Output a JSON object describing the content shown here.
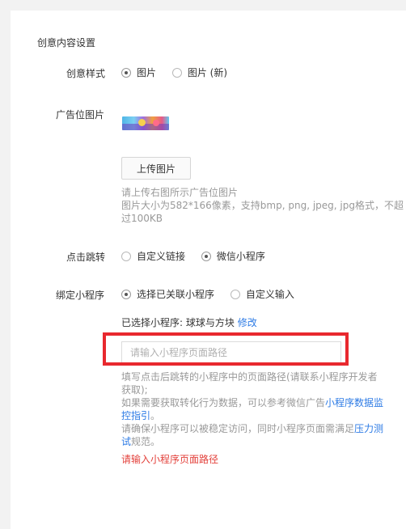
{
  "section_title": "创意内容设置",
  "style_row": {
    "label": "创意样式",
    "options": [
      "图片",
      "图片 (新)"
    ],
    "selected": 0
  },
  "image_row": {
    "label": "广告位图片",
    "upload_label": "上传图片",
    "help_line1": "请上传右图所示广告位图片",
    "help_line2": "图片大小为582*166像素，支持bmp, png, jpeg, jpg格式，不超",
    "help_line3": "过100KB"
  },
  "jump_row": {
    "label": "点击跳转",
    "options": [
      "自定义链接",
      "微信小程序"
    ],
    "selected": 1
  },
  "bind_row": {
    "label": "绑定小程序",
    "options": [
      "选择已关联小程序",
      "自定义输入"
    ],
    "selected": 0,
    "selected_text": "已选择小程序: 球球与方块",
    "modify_link": "修改",
    "path_placeholder": "请输入小程序页面路径",
    "help1_line1": "填写点击后跳转的小程序中的页面路径(请联系小程序开发者",
    "help1_line2": "获取);",
    "help2_prefix": "如果需要获取转化行为数据，可以参考微信广告",
    "help2_link_a": "小程序数据监",
    "help2_link_b": "控指引",
    "help2_suffix": "。",
    "help3_prefix": "请确保小程序可以被稳定访问，同时小程序页面需满足",
    "help3_link_a": "压力测",
    "help3_link_b": "试",
    "help3_suffix": "规范。",
    "error_text": "请输入小程序页面路径"
  },
  "colors": {
    "link": "#2d7be5",
    "error": "#e3413b",
    "highlight": "#e8282e"
  }
}
